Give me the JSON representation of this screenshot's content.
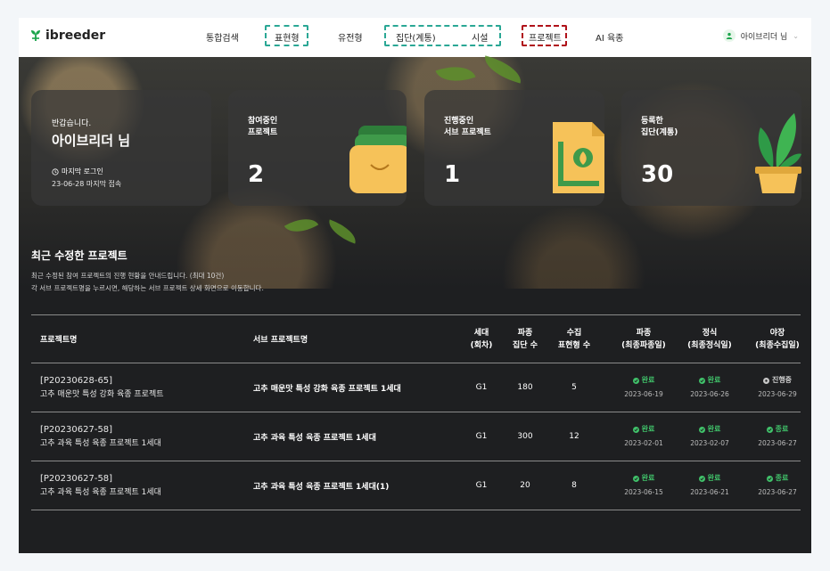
{
  "header": {
    "brand": "ibreeder",
    "nav": [
      "통합검색",
      "표현형",
      "유전형",
      "집단(계통)",
      "시설",
      "프로젝트",
      "AI 육종"
    ],
    "user_label": "아이브리더 님"
  },
  "welcome": {
    "greeting": "반갑습니다.",
    "name": "아이브리더 님",
    "last_login_label": "마지막 로그인",
    "last_login_value": "23-06-28 마지막 접속"
  },
  "stats": [
    {
      "label_line1": "참여중인",
      "label_line2": "프로젝트",
      "value": "2"
    },
    {
      "label_line1": "진행중인",
      "label_line2": "서브 프로젝트",
      "value": "1"
    },
    {
      "label_line1": "등록한",
      "label_line2": "집단(계통)",
      "value": "30"
    }
  ],
  "section": {
    "title": "최근 수정한 프로젝트",
    "desc1": "최근 수정된 참여 프로젝트의 진행 현황을 안내드립니다. (최대 10건)",
    "desc2": "각 서브 프로젝트명을 누르시면, 해당하는 서브 프로젝트 상세 화면으로 이동합니다."
  },
  "table": {
    "headers": {
      "project": "프로젝트명",
      "sub": "서브 프로젝트명",
      "gen_1": "세대",
      "gen_2": "(회차)",
      "grp_1": "파종",
      "grp_2": "집단 수",
      "phe_1": "수집",
      "phe_2": "표현형 수",
      "s1_1": "파종",
      "s1_2": "(최종파종일)",
      "s2_1": "정식",
      "s2_2": "(최종정식일)",
      "s3_1": "야장",
      "s3_2": "(최종수집일)"
    },
    "rows": [
      {
        "id": "[P20230628-65]",
        "name": "고추 매운맛 특성 강화 육종 프로젝트",
        "sub": "고추 매운맛 특성 강화 육종 프로젝트 1세대",
        "gen": "G1",
        "groups": "180",
        "phenotypes": "5",
        "s1": "완료",
        "s1_date": "2023-06-19",
        "s2": "완료",
        "s2_date": "2023-06-26",
        "s3": "진행중",
        "s3_date": "2023-06-29"
      },
      {
        "id": "[P20230627-58]",
        "name": "고추 과육 특성 육종 프로젝트 1세대",
        "sub": "고추 과육 특성 육종 프로젝트 1세대",
        "gen": "G1",
        "groups": "300",
        "phenotypes": "12",
        "s1": "완료",
        "s1_date": "2023-02-01",
        "s2": "완료",
        "s2_date": "2023-02-07",
        "s3": "종료",
        "s3_date": "2023-06-27"
      },
      {
        "id": "[P20230627-58]",
        "name": "고추 과육 특성 육종 프로젝트 1세대",
        "sub": "고추 과육 특성 육종 프로젝트 1세대(1)",
        "gen": "G1",
        "groups": "20",
        "phenotypes": "8",
        "s1": "완료",
        "s1_date": "2023-06-15",
        "s2": "완료",
        "s2_date": "2023-06-21",
        "s3": "종료",
        "s3_date": "2023-06-27"
      }
    ]
  },
  "colors": {
    "accent_green": "#40c26a",
    "highlight_teal": "#2aa795",
    "highlight_red": "#b0111a"
  }
}
